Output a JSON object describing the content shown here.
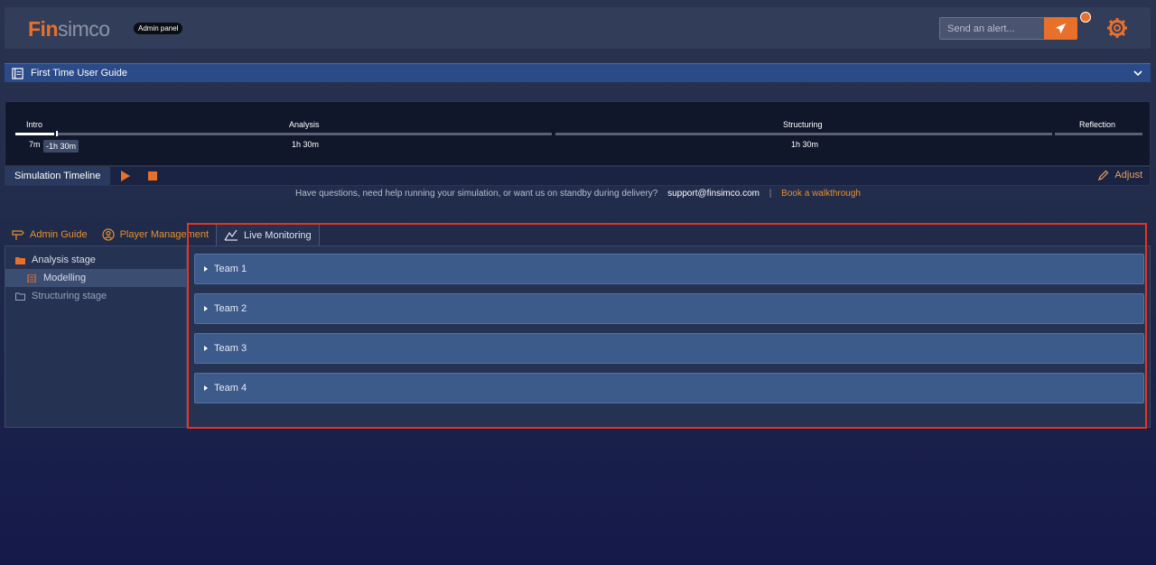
{
  "header": {
    "logo_accent": "Fin",
    "logo_rest": "simco",
    "admin_badge": "Admin panel",
    "alert_placeholder": "Send an alert..."
  },
  "guide": {
    "title": "First Time User Guide"
  },
  "timeline": {
    "phases": [
      {
        "label": "Intro",
        "time": "7m"
      },
      {
        "label": "Analysis",
        "time": "1h 30m"
      },
      {
        "label": "Structuring",
        "time": "1h 30m"
      },
      {
        "label": "Reflection",
        "time": ""
      }
    ],
    "cursor_label": "-1h 30m",
    "title": "Simulation Timeline",
    "adjust_label": "Adjust"
  },
  "help": {
    "question": "Have questions, need help running your simulation, or want us on standby during delivery?",
    "email": "support@finsimco.com",
    "separator": "|",
    "book_link": "Book a walkthrough"
  },
  "tabs": [
    {
      "label": "Admin Guide",
      "icon": "signpost-icon"
    },
    {
      "label": "Player Management",
      "icon": "user-circle-icon"
    },
    {
      "label": "Live Monitoring",
      "icon": "chart-pen-icon",
      "active": true
    }
  ],
  "tree": {
    "items": [
      {
        "label": "Analysis stage",
        "icon": "folder-icon"
      },
      {
        "label": "Modelling",
        "icon": "document-icon"
      },
      {
        "label": "Structuring stage",
        "icon": "folder-outline-icon"
      }
    ]
  },
  "teams": [
    {
      "label": "Team 1"
    },
    {
      "label": "Team 2"
    },
    {
      "label": "Team 3"
    },
    {
      "label": "Team 4"
    }
  ],
  "colors": {
    "accent": "#e8702a",
    "highlight": "#e8331c",
    "team_row": "#3c5a8a"
  }
}
